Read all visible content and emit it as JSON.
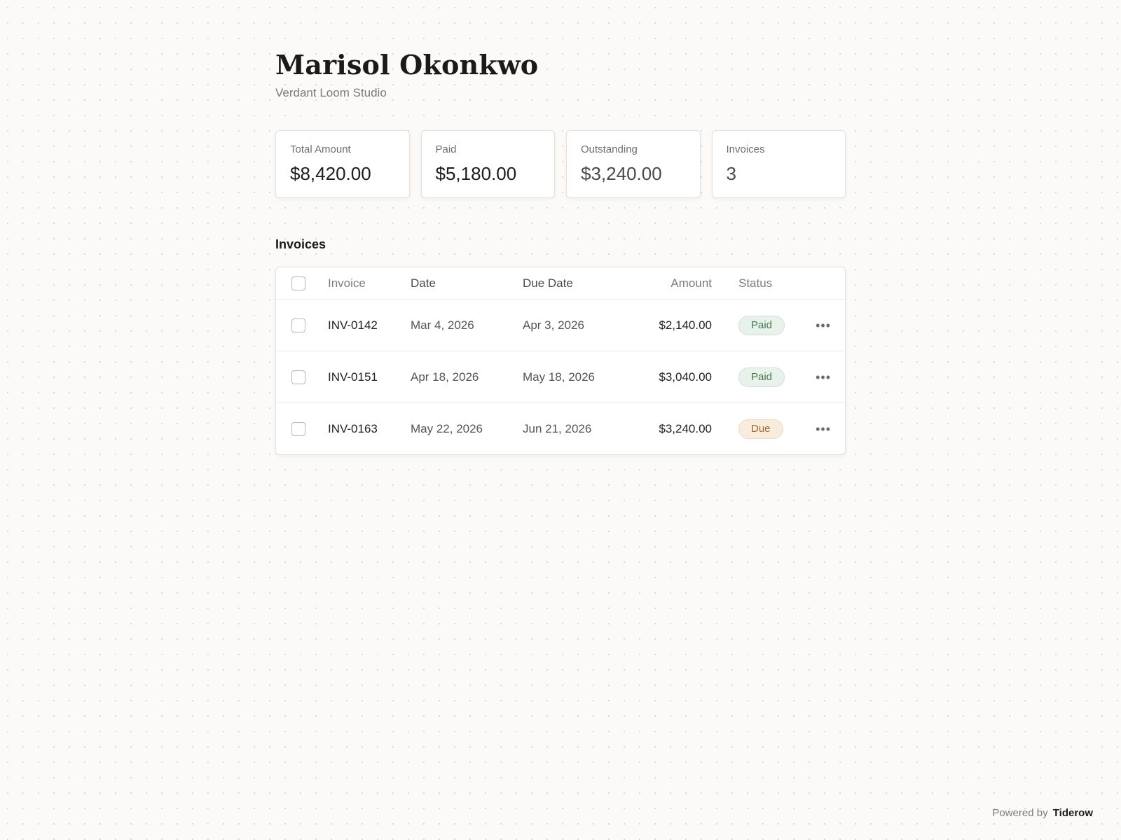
{
  "client": {
    "name": "Marisol Okonkwo",
    "company": "Verdant Loom Studio"
  },
  "stats": [
    {
      "label": "Total Amount",
      "value": "$8,420.00"
    },
    {
      "label": "Paid",
      "value": "$5,180.00"
    },
    {
      "label": "Outstanding",
      "value": "$3,240.00"
    },
    {
      "label": "Invoices",
      "value": "3"
    }
  ],
  "invoices_section": {
    "title": "Invoices",
    "columns": {
      "invoice": "Invoice",
      "date": "Date",
      "due_date": "Due Date",
      "amount": "Amount",
      "status": "Status"
    },
    "rows": [
      {
        "invoice": "INV-0142",
        "date": "Mar 4, 2026",
        "due_date": "Apr 3, 2026",
        "amount": "$2,140.00",
        "status": "Paid"
      },
      {
        "invoice": "INV-0151",
        "date": "Apr 18, 2026",
        "due_date": "May 18, 2026",
        "amount": "$3,040.00",
        "status": "Paid"
      },
      {
        "invoice": "INV-0163",
        "date": "May 22, 2026",
        "due_date": "Jun 21, 2026",
        "amount": "$3,240.00",
        "status": "Due"
      }
    ],
    "menu_glyph": "•••"
  },
  "footer": {
    "powered_by": "Powered by",
    "brand": "Tiderow"
  },
  "colors": {
    "paid_badge": "#3d7a4f",
    "due_badge": "#9a6a2a"
  }
}
